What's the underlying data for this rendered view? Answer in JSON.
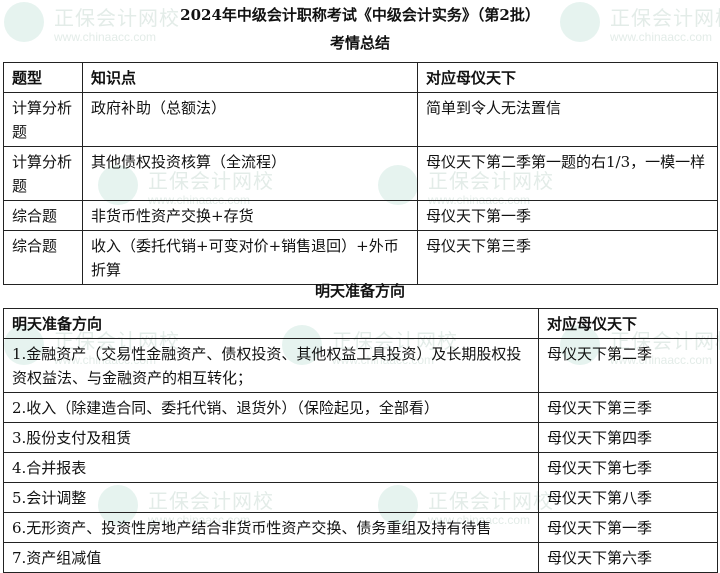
{
  "watermark": {
    "brand": "正保会计网校",
    "url": "www.chinaacc.com"
  },
  "title": "2024年中级会计职称考试《中级会计实务》（第2批）",
  "section1": {
    "heading": "考情总结",
    "headers": [
      "题型",
      "知识点",
      "对应母仪天下"
    ],
    "rows": [
      [
        "计算分析题",
        "政府补助（总额法）",
        "简单到令人无法置信"
      ],
      [
        "计算分析题",
        "其他债权投资核算（全流程）",
        "母仪天下第二季第一题的右1/3，一模一样"
      ],
      [
        "综合题",
        "非货币性资产交换+存货",
        "母仪天下第一季"
      ],
      [
        "综合题",
        "收入（委托代销+可变对价+销售退回）+外币折算",
        "母仪天下第三季"
      ]
    ]
  },
  "section2": {
    "heading": "明天准备方向",
    "headers": [
      "明天准备方向",
      "对应母仪天下"
    ],
    "rows": [
      [
        "1.金融资产（交易性金融资产、债权投资、其他权益工具投资）及长期股权投资权益法、与金融资产的相互转化；",
        "母仪天下第二季"
      ],
      [
        "2.收入（除建造合同、委托代销、退货外）（保险起见，全部看）",
        "母仪天下第三季"
      ],
      [
        "3.股份支付及租赁",
        "母仪天下第四季"
      ],
      [
        "4.合并报表",
        "母仪天下第七季"
      ],
      [
        "5.会计调整",
        "母仪天下第八季"
      ],
      [
        "6.无形资产、投资性房地产结合非货币性资产交换、债务重组及持有待售",
        "母仪天下第一季"
      ],
      [
        "7.资产组减值",
        "母仪天下第六季"
      ]
    ]
  }
}
